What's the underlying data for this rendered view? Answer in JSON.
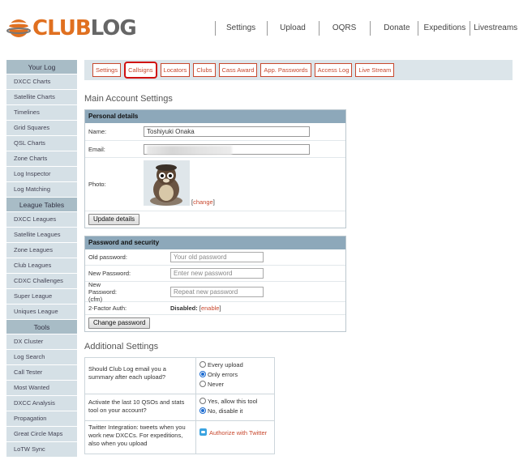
{
  "brand": {
    "club": "CLUB",
    "log": "LOG"
  },
  "topnav": [
    "Settings",
    "Upload",
    "OQRS",
    "Donate",
    "Expeditions",
    "Livestreams"
  ],
  "sidebar": {
    "your_log": {
      "heading": "Your Log",
      "items": [
        "DXCC Charts",
        "Satellite Charts",
        "Timelines",
        "Grid Squares",
        "QSL Charts",
        "Zone Charts",
        "Log Inspector",
        "Log Matching"
      ]
    },
    "league_tables": {
      "heading": "League Tables",
      "items": [
        "DXCC Leagues",
        "Satellite Leagues",
        "Zone Leagues",
        "Club Leagues",
        "CDXC Challenges",
        "Super League",
        "Uniques League"
      ]
    },
    "tools": {
      "heading": "Tools",
      "items": [
        "DX Cluster",
        "Log Search",
        "Call Tester",
        "Most Wanted",
        "DXCC Analysis",
        "Propagation",
        "Great Circle Maps",
        "LoTW Sync"
      ]
    }
  },
  "tabs": [
    "Settings",
    "Callsigns",
    "Locators",
    "Clubs",
    "Cass Award",
    "App. Passwords",
    "Access Log",
    "Live Stream"
  ],
  "active_tab": "Callsigns",
  "main_title": "Main Account Settings",
  "personal": {
    "heading": "Personal details",
    "name_label": "Name:",
    "name_value": "Toshiyuki Onaka",
    "email_label": "Email:",
    "photo_label": "Photo:",
    "change_open": "[",
    "change_link": "change",
    "change_close": "]",
    "update_button": "Update details"
  },
  "password": {
    "heading": "Password and security",
    "old_label": "Old password:",
    "old_placeholder": "Your old password",
    "new_label": "New Password:",
    "new_placeholder": "Enter new password",
    "cfm_label": "New Password: (cfm)",
    "cfm_placeholder": "Repeat new password",
    "twofa_label": "2-Factor Auth:",
    "twofa_status": "Disabled:",
    "twofa_open": "[",
    "twofa_link": "enable",
    "twofa_close": "]",
    "change_button": "Change password"
  },
  "additional": {
    "title": "Additional Settings",
    "email_q": "Should Club Log email you a summary after each upload?",
    "email_opts": [
      "Every upload",
      "Only errors",
      "Never"
    ],
    "email_selected": 1,
    "tool_q": "Activate the last 10 QSOs and stats tool on your account?",
    "tool_opts": [
      "Yes, allow this tool",
      "No, disable it"
    ],
    "tool_selected": 1,
    "twitter_q": "Twitter Integration: tweets when you work new DXCCs. For expeditions, also when you upload",
    "twitter_link": "Authorize with Twitter"
  },
  "colors": {
    "accent": "#c8482e",
    "active_tab_border": "#d01010",
    "sidebar_head": "#a8bcc6",
    "sidebar_item": "#d5e0e6",
    "panel_head": "#8da8ba"
  }
}
